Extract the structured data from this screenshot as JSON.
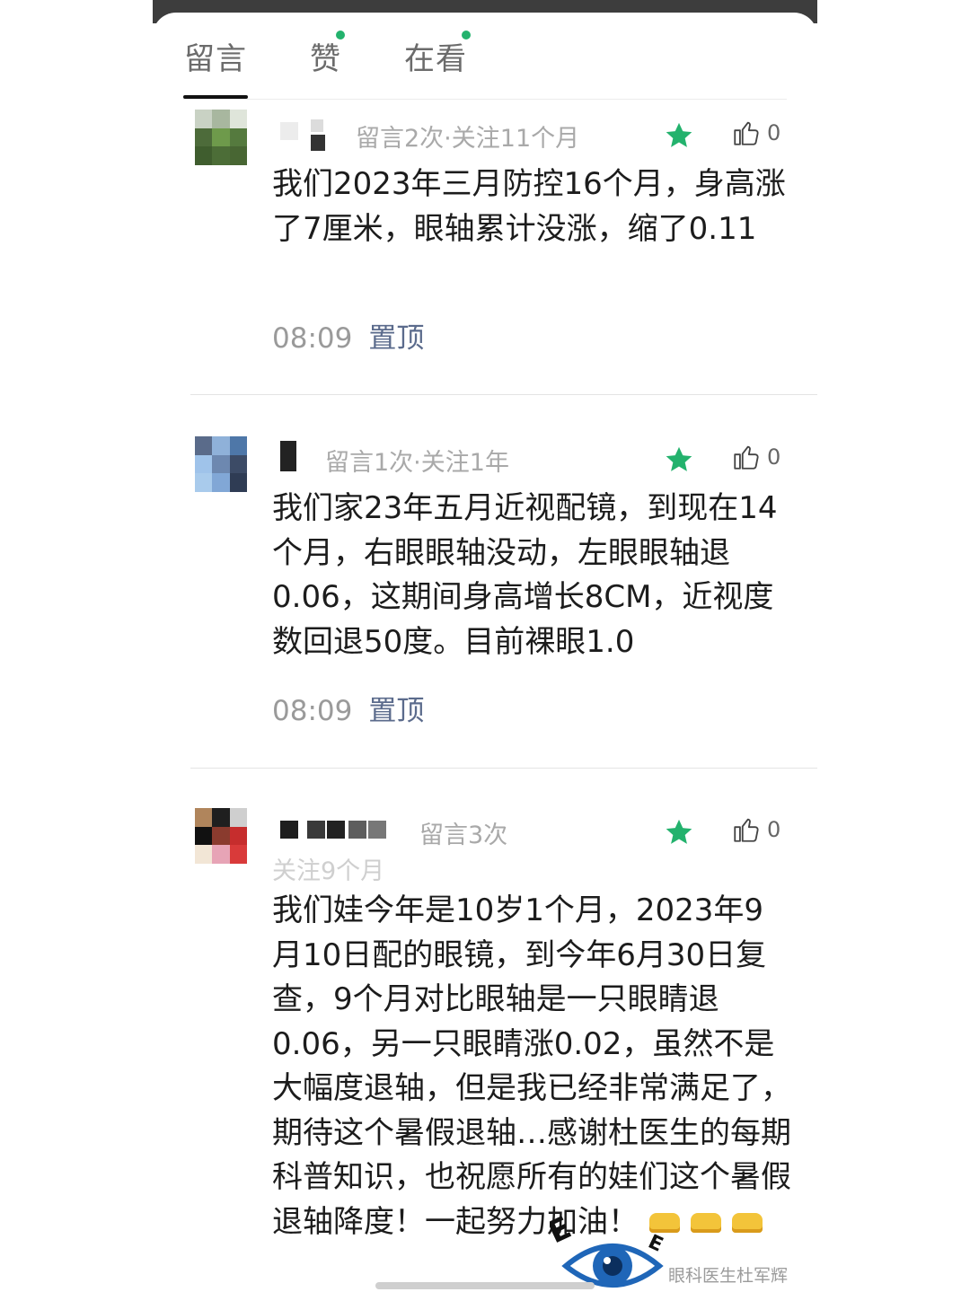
{
  "tabs": [
    {
      "label": "留言",
      "active": true,
      "badge": false
    },
    {
      "label": "赞",
      "active": false,
      "badge": true
    },
    {
      "label": "在看",
      "active": false,
      "badge": true
    }
  ],
  "comments": [
    {
      "meta": "留言2次·关注11个月",
      "likes": "0",
      "text": "我们2023年三月防控16个月，身高涨了7厘米，眼轴累计没涨，缩了0.11",
      "time": "08:09",
      "pin": "置顶"
    },
    {
      "meta": "留言1次·关注1年",
      "likes": "0",
      "text": "我们家23年五月近视配镜，到现在14个月，右眼眼轴没动，左眼眼轴退0.06，这期间身高增长8CM，近视度数回退50度。目前裸眼1.0",
      "time": "08:09",
      "pin": "置顶"
    },
    {
      "meta": "留言3次",
      "meta2": "关注9个月",
      "likes": "0",
      "text": "我们娃今年是10岁1个月，2023年9月10日配的眼镜，到今年6月30日复查，9个月对比眼轴是一只眼睛退0.06，另一只眼睛涨0.02，虽然不是大幅度退轴，但是我已经非常满足了，期待这个暑假退轴…感谢杜医生的每期科普知识，也祝愿所有的娃们这个暑假退轴降度！一起努力加油！"
    }
  ],
  "watermark": "眼科医生杜军辉",
  "colors": {
    "accent": "#23b26d",
    "pin": "#5b6b8c",
    "meta": "#a9a9a9"
  },
  "icons": [
    "star-icon",
    "thumb-up-icon",
    "eye-logo-icon"
  ]
}
